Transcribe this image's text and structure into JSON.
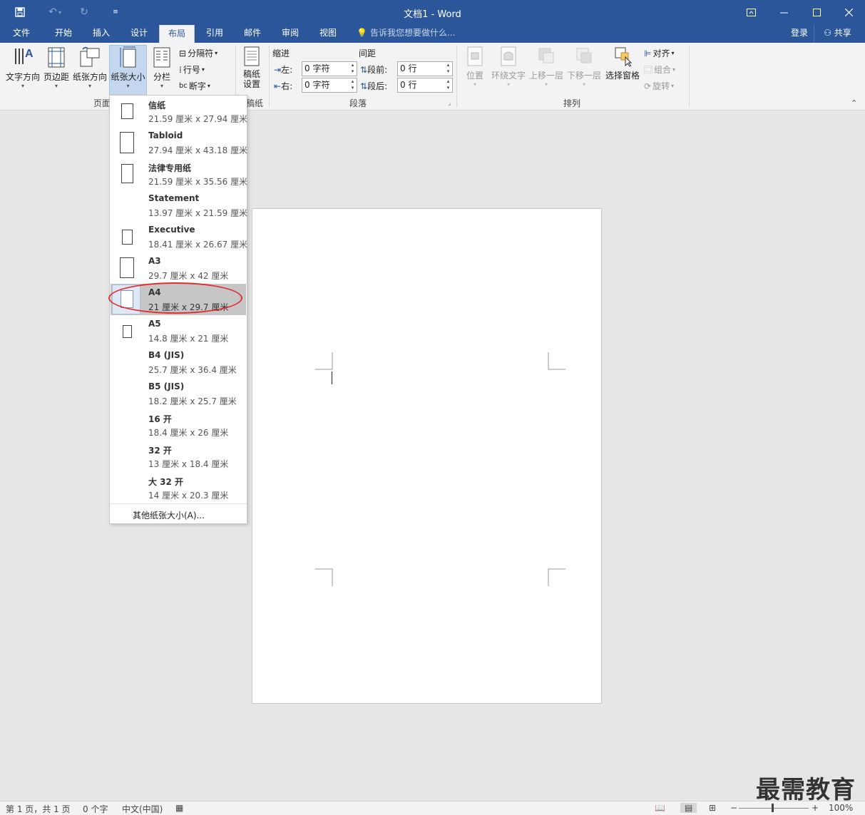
{
  "titlebar": {
    "title": "文档1 - Word",
    "quick_access": [
      "save-icon",
      "undo-icon",
      "redo-icon",
      "customize-icon"
    ],
    "color": "#2b579a"
  },
  "tabs": [
    {
      "label": "文件"
    },
    {
      "label": "开始"
    },
    {
      "label": "插入"
    },
    {
      "label": "设计"
    },
    {
      "label": "布局"
    },
    {
      "label": "引用"
    },
    {
      "label": "邮件"
    },
    {
      "label": "审阅"
    },
    {
      "label": "视图"
    }
  ],
  "active_tab": "布局",
  "tell_me": "告诉我您想要做什么...",
  "account": {
    "login": "登录",
    "share": "共享"
  },
  "ribbon": {
    "page_setup": {
      "text_direction": "文字方向",
      "margins": "页边距",
      "orientation": "纸张方向",
      "size": "纸张大小",
      "columns": "分栏",
      "breaks": "分隔符",
      "line_numbers": "行号",
      "hyphenation": "断字",
      "group_label": "页面"
    },
    "manuscript": {
      "label": "稿纸\n设置",
      "label1": "稿纸",
      "label2": "设置",
      "group_label": "稿纸"
    },
    "paragraph": {
      "indent_header": "缩进",
      "spacing_header": "间距",
      "left_label": "左:",
      "right_label": "右:",
      "before_label": "段前:",
      "after_label": "段后:",
      "left_value": "0 字符",
      "right_value": "0 字符",
      "before_value": "0 行",
      "after_value": "0 行",
      "group_label": "段落"
    },
    "arrange": {
      "position": "位置",
      "wrap_text": "环绕文字",
      "bring_forward": "上移一层",
      "send_backward": "下移一层",
      "selection_pane": "选择窗格",
      "align": "对齐",
      "group": "组合",
      "rotate": "旋转",
      "group_label": "排列"
    }
  },
  "paper_sizes": [
    {
      "name": "信纸",
      "size": "21.59 厘米 x 27.94 厘米"
    },
    {
      "name": "Tabloid",
      "size": "27.94 厘米 x 43.18 厘米"
    },
    {
      "name": "法律专用纸",
      "size": "21.59 厘米 x 35.56 厘米"
    },
    {
      "name": "Statement",
      "size": "13.97 厘米 x 21.59 厘米"
    },
    {
      "name": "Executive",
      "size": "18.41 厘米 x 26.67 厘米"
    },
    {
      "name": "A3",
      "size": "29.7 厘米 x 42 厘米"
    },
    {
      "name": "A4",
      "size": "21 厘米 x 29.7 厘米"
    },
    {
      "name": "A5",
      "size": "14.8 厘米 x 21 厘米"
    },
    {
      "name": "B4 (JIS)",
      "size": "25.7 厘米 x 36.4 厘米"
    },
    {
      "name": "B5 (JIS)",
      "size": "18.2 厘米 x 25.7 厘米"
    },
    {
      "name": "16 开",
      "size": "18.4 厘米 x 26 厘米"
    },
    {
      "name": "32 开",
      "size": "13 厘米 x 18.4 厘米"
    },
    {
      "name": "大 32 开",
      "size": "14 厘米 x 20.3 厘米"
    }
  ],
  "selected_paper": "A4",
  "more_sizes": "其他纸张大小(A)...",
  "status": {
    "page": "第 1 页，共 1 页",
    "words": "0 个字",
    "language": "中文(中国)",
    "zoom": "100%"
  },
  "watermark": "最需教育",
  "colors": {
    "accent": "#2b579a",
    "highlight_circle": "#e03030",
    "selected_row": "#c6c6c6"
  }
}
